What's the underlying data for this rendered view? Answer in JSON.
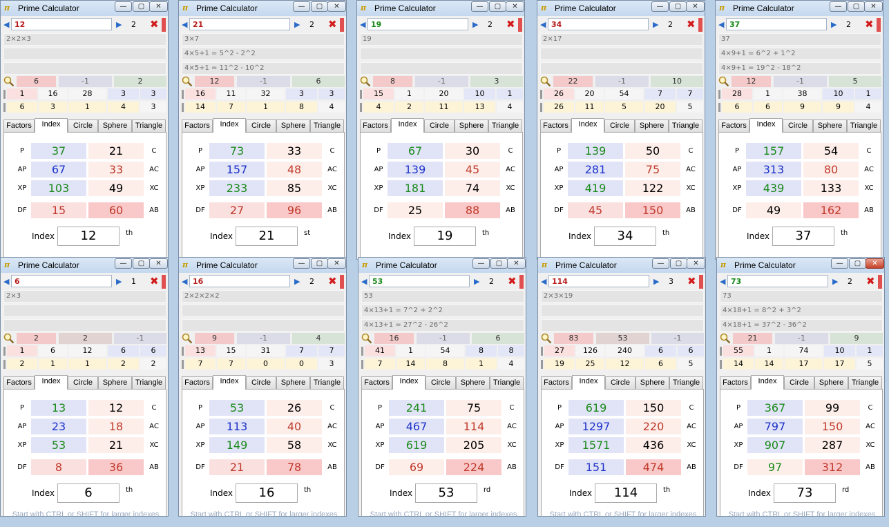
{
  "colors": {
    "title_bar": "#c5d8ee",
    "prime_text": "#1a8a1a",
    "composite_text": "#b81d1d",
    "blue_text": "#1d33c9",
    "red_text": "#c0392b"
  },
  "common": {
    "title": "Prime Calculator",
    "tabs": [
      "Factors",
      "Index",
      "Circle",
      "Sphere",
      "Triangle"
    ],
    "labels_left": [
      "P",
      "AP",
      "XP",
      "DF"
    ],
    "labels_right": [
      "C",
      "AC",
      "XC",
      "AB"
    ],
    "index_label": "Index",
    "hint": "Start with CTRL or SHIFT for larger indexes",
    "min_glyph": "—",
    "max_glyph": "▢",
    "close_glyph": "✕",
    "close_x_glyph": "✖",
    "nav_left_icon": "triangle-left-icon",
    "nav_right_icon": "triangle-right-icon",
    "search_icon": "magnifier-icon"
  },
  "windows": [
    {
      "number": "12",
      "prime": false,
      "digits": "2",
      "lines": [
        "2×2×3",
        "",
        ""
      ],
      "row3": [
        "6",
        "-1",
        "2"
      ],
      "row4": [
        "1",
        "16",
        "28",
        "3",
        "3"
      ],
      "row5": [
        "6",
        "3",
        "1",
        "4",
        "3"
      ],
      "grid": {
        "P": "37",
        "C": "21",
        "AP": "67",
        "AC": "33",
        "XP": "103",
        "XC": "49",
        "DF": "15",
        "AB": "60"
      },
      "index": "12",
      "suffix": "th",
      "show_hint": false,
      "active": false
    },
    {
      "number": "21",
      "prime": false,
      "digits": "2",
      "lines": [
        "3×7",
        "4×5+1 = 5^2 - 2^2",
        "4×5+1 = 11^2 - 10^2"
      ],
      "row3": [
        "12",
        "-1",
        "6"
      ],
      "row4": [
        "16",
        "11",
        "32",
        "3",
        "3"
      ],
      "row5": [
        "14",
        "7",
        "1",
        "8",
        "4"
      ],
      "grid": {
        "P": "73",
        "C": "33",
        "AP": "157",
        "AC": "48",
        "XP": "233",
        "XC": "85",
        "DF": "27",
        "AB": "96"
      },
      "index": "21",
      "suffix": "st",
      "show_hint": false,
      "active": false
    },
    {
      "number": "19",
      "prime": true,
      "digits": "2",
      "lines": [
        "19",
        "",
        ""
      ],
      "row3": [
        "8",
        "-1",
        "3"
      ],
      "row4": [
        "15",
        "1",
        "20",
        "10",
        "1"
      ],
      "row5": [
        "4",
        "2",
        "11",
        "13",
        "4"
      ],
      "grid": {
        "P": "67",
        "C": "30",
        "AP": "139",
        "AC": "45",
        "XP": "181",
        "XC": "74",
        "DF": "25",
        "AB": "88"
      },
      "index": "19",
      "suffix": "th",
      "show_hint": false,
      "active": false
    },
    {
      "number": "34",
      "prime": false,
      "digits": "2",
      "lines": [
        "2×17",
        "",
        ""
      ],
      "row3": [
        "22",
        "-1",
        "10"
      ],
      "row4": [
        "26",
        "20",
        "54",
        "7",
        "7"
      ],
      "row5": [
        "26",
        "11",
        "5",
        "20",
        "5"
      ],
      "grid": {
        "P": "139",
        "C": "50",
        "AP": "281",
        "AC": "75",
        "XP": "419",
        "XC": "122",
        "DF": "45",
        "AB": "150"
      },
      "index": "34",
      "suffix": "th",
      "show_hint": false,
      "active": false
    },
    {
      "number": "37",
      "prime": true,
      "digits": "2",
      "lines": [
        "37",
        "4×9+1 = 6^2 + 1^2",
        "4×9+1 = 19^2 - 18^2"
      ],
      "row3": [
        "12",
        "-1",
        "5"
      ],
      "row4": [
        "28",
        "1",
        "38",
        "10",
        "1"
      ],
      "row5": [
        "6",
        "6",
        "9",
        "9",
        "4"
      ],
      "grid": {
        "P": "157",
        "C": "54",
        "AP": "313",
        "AC": "80",
        "XP": "439",
        "XC": "133",
        "DF": "49",
        "AB": "162"
      },
      "index": "37",
      "suffix": "th",
      "show_hint": false,
      "active": false
    },
    {
      "number": "6",
      "prime": false,
      "digits": "1",
      "lines": [
        "2×3",
        "",
        ""
      ],
      "row3": [
        "2",
        "2",
        "-1"
      ],
      "row4": [
        "1",
        "6",
        "12",
        "6",
        "6"
      ],
      "row5": [
        "2",
        "1",
        "1",
        "2",
        "2"
      ],
      "grid": {
        "P": "13",
        "C": "12",
        "AP": "23",
        "AC": "18",
        "XP": "53",
        "XC": "21",
        "DF": "8",
        "AB": "36"
      },
      "index": "6",
      "suffix": "th",
      "show_hint": true,
      "active": false
    },
    {
      "number": "16",
      "prime": false,
      "digits": "2",
      "lines": [
        "2×2×2×2",
        "",
        ""
      ],
      "row3": [
        "9",
        "-1",
        "4"
      ],
      "row4": [
        "13",
        "15",
        "31",
        "7",
        "7"
      ],
      "row5": [
        "7",
        "7",
        "0",
        "0",
        "3"
      ],
      "grid": {
        "P": "53",
        "C": "26",
        "AP": "113",
        "AC": "40",
        "XP": "149",
        "XC": "58",
        "DF": "21",
        "AB": "78"
      },
      "index": "16",
      "suffix": "th",
      "show_hint": true,
      "active": false
    },
    {
      "number": "53",
      "prime": true,
      "digits": "2",
      "lines": [
        "53",
        "4×13+1 = 7^2 + 2^2",
        "4×13+1 = 27^2 - 26^2"
      ],
      "row3": [
        "16",
        "-1",
        "6"
      ],
      "row4": [
        "41",
        "1",
        "54",
        "8",
        "8"
      ],
      "row5": [
        "7",
        "14",
        "8",
        "1",
        "4"
      ],
      "grid": {
        "P": "241",
        "C": "75",
        "AP": "467",
        "AC": "114",
        "XP": "619",
        "XC": "205",
        "DF": "69",
        "AB": "224"
      },
      "index": "53",
      "suffix": "rd",
      "show_hint": true,
      "active": false
    },
    {
      "number": "114",
      "prime": false,
      "digits": "3",
      "lines": [
        "2×3×19",
        "",
        ""
      ],
      "row3": [
        "83",
        "53",
        "-1"
      ],
      "row4": [
        "27",
        "126",
        "240",
        "6",
        "6"
      ],
      "row5": [
        "19",
        "25",
        "12",
        "6",
        "5"
      ],
      "grid": {
        "P": "619",
        "C": "150",
        "AP": "1297",
        "AC": "220",
        "XP": "1571",
        "XC": "436",
        "DF": "151",
        "AB": "474"
      },
      "index": "114",
      "suffix": "th",
      "show_hint": true,
      "active": false
    },
    {
      "number": "73",
      "prime": true,
      "digits": "2",
      "lines": [
        "73",
        "4×18+1 = 8^2 + 3^2",
        "4×18+1 = 37^2 - 36^2"
      ],
      "row3": [
        "21",
        "-1",
        "9"
      ],
      "row4": [
        "55",
        "1",
        "74",
        "10",
        "1"
      ],
      "row5": [
        "14",
        "14",
        "17",
        "17",
        "5"
      ],
      "grid": {
        "P": "367",
        "C": "99",
        "AP": "797",
        "AC": "150",
        "XP": "907",
        "XC": "287",
        "DF": "97",
        "AB": "312"
      },
      "index": "73",
      "suffix": "rd",
      "show_hint": true,
      "active": true
    }
  ]
}
